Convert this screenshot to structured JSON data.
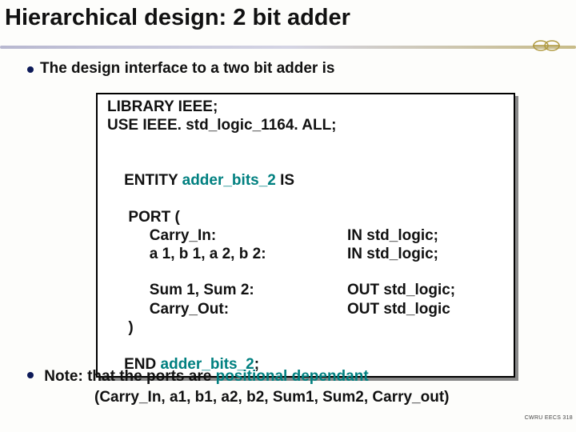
{
  "title": "Hierarchical design: 2 bit adder",
  "bullet1": "The design interface to a two bit adder is",
  "code": {
    "l1": "LIBRARY IEEE;",
    "l2": "USE IEEE. std_logic_1164. ALL;",
    "l3a": "ENTITY ",
    "l3b": "adder_bits_2",
    "l3c": " IS",
    "l4": "     PORT (",
    "l5l": "          Carry_In:",
    "l5r": "IN std_logic;",
    "l6l": "          a 1, b 1, a 2, b 2:",
    "l6r": "IN std_logic;",
    "l7l": "          Sum 1, Sum 2:",
    "l7r": "OUT std_logic;",
    "l8l": "          Carry_Out:",
    "l8r": "OUT std_logic",
    "l9": "     )",
    "l10a": "END ",
    "l10b": "adder_bits_2",
    "l10c": ";"
  },
  "note1a": "Note: that the ports are ",
  "note1b": "positional dependant",
  "note2": "(Carry_In, a1, b1, a2, b2, Sum1, Sum2, Carry_out)",
  "footer": "CWRU EECS 318"
}
